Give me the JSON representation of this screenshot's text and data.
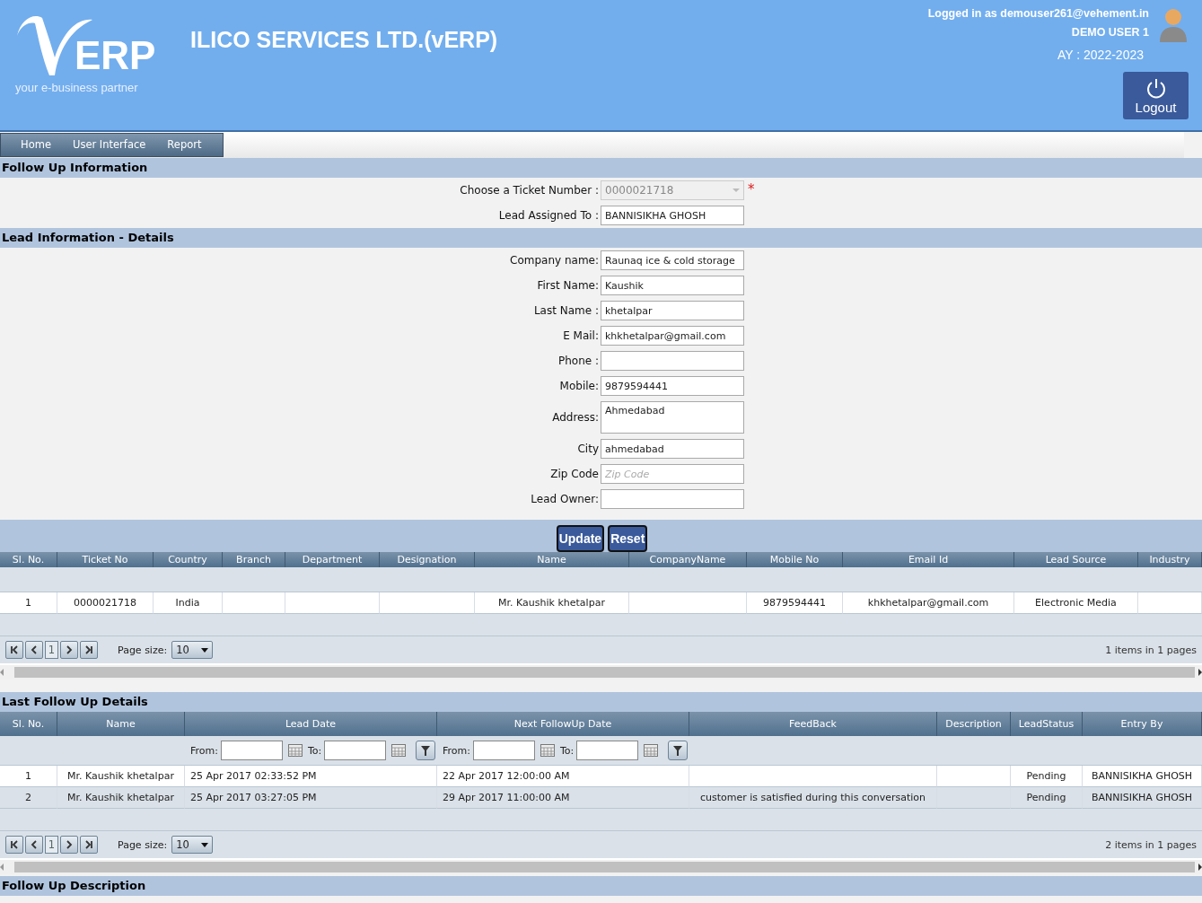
{
  "header": {
    "logo_text": "ERP",
    "tagline": "your e-business partner",
    "company": "ILICO SERVICES LTD.(vERP)",
    "logged_in": "Logged in as demouser261@vehement.in",
    "user": "DEMO USER 1",
    "year": "AY : 2022-2023",
    "logout": "Logout"
  },
  "nav": [
    {
      "label": "Home"
    },
    {
      "label": "User Interface"
    },
    {
      "label": "Report"
    }
  ],
  "follow_up_info": {
    "title": "Follow Up Information",
    "fields": [
      {
        "kind": "select",
        "label": "Choose a Ticket Number :",
        "value": "0000021718",
        "disabled": true,
        "required": "*"
      },
      {
        "kind": "text",
        "label": "Lead Assigned To :",
        "value": "BANNISIKHA GHOSH"
      }
    ]
  },
  "lead_info": {
    "title": "Lead Information - Details",
    "fields": [
      {
        "kind": "text",
        "label": "Company name:",
        "value": "Raunaq ice & cold storage"
      },
      {
        "kind": "text",
        "label": "First Name:",
        "value": "Kaushik"
      },
      {
        "kind": "text",
        "label": "Last Name :",
        "value": "khetalpar"
      },
      {
        "kind": "text",
        "label": "E Mail:",
        "value": "khkhetalpar@gmail.com"
      },
      {
        "kind": "text",
        "label": "Phone :"
      },
      {
        "kind": "text",
        "label": "Mobile:",
        "value": "9879594441"
      },
      {
        "kind": "textarea",
        "label": "Address:",
        "value": "Ahmedabad"
      },
      {
        "kind": "text",
        "label": "City",
        "value": "ahmedabad"
      },
      {
        "kind": "text",
        "label": "Zip Code",
        "placeholder": "Zip Code"
      },
      {
        "kind": "text",
        "label": "Lead Owner:"
      }
    ]
  },
  "buttons": [
    "Update",
    "Reset"
  ],
  "lead_table": {
    "columns": [
      "Sl. No.",
      "Ticket No",
      "Country",
      "Branch",
      "Department",
      "Designation",
      "Name",
      "CompanyName",
      "Mobile No",
      "Email Id",
      "Lead Source",
      "Industry"
    ],
    "rows": [
      [
        "1",
        "0000021718",
        "India",
        null,
        null,
        null,
        "Mr. Kaushik khetalpar",
        null,
        "9879594441",
        "khkhetalpar@gmail.com",
        "Electronic Media",
        null
      ]
    ],
    "pager": {
      "page": "1",
      "page_size_label": "Page size:",
      "page_size": "10",
      "summary": "1 items in 1 pages"
    }
  },
  "last_follow_up": {
    "title": "Last Follow Up Details",
    "columns": [
      "Sl. No.",
      "Name",
      "Lead Date",
      "Next FollowUp Date",
      "FeedBack",
      "Description",
      "LeadStatus",
      "Entry By"
    ],
    "filters": [
      {
        "from": "From:",
        "to": "To:"
      },
      {
        "from": "From:",
        "to": "To:"
      }
    ],
    "rows": [
      [
        "1",
        "Mr. Kaushik khetalpar",
        "25 Apr 2017 02:33:52 PM",
        "22 Apr 2017 12:00:00 AM",
        null,
        null,
        "Pending",
        "BANNISIKHA GHOSH"
      ],
      [
        "2",
        "Mr. Kaushik khetalpar",
        "25 Apr 2017 03:27:05 PM",
        "29 Apr 2017 11:00:00 AM",
        "customer is satisfied during this conversation",
        null,
        "Pending",
        "BANNISIKHA GHOSH"
      ]
    ],
    "pager": {
      "page": "1",
      "page_size_label": "Page size:",
      "page_size": "10",
      "summary": "2 items in 1 pages"
    }
  },
  "follow_up_description": {
    "title": "Follow Up Description"
  }
}
